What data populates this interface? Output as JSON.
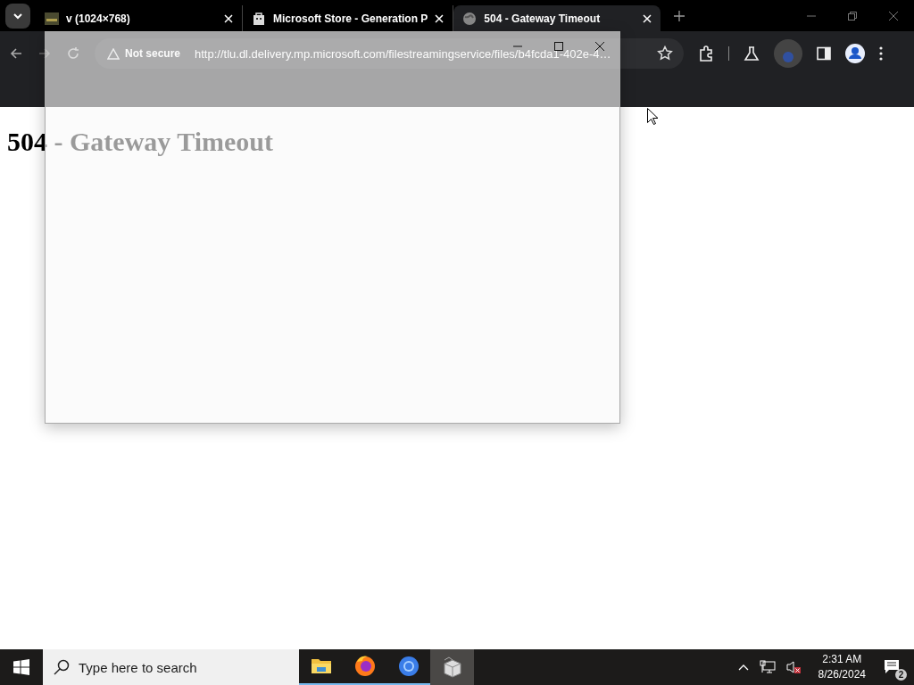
{
  "tabs": [
    {
      "title": "v (1024×768)",
      "kind": "thumbnail",
      "selected": false
    },
    {
      "title": "Microsoft Store - Generation P",
      "kind": "store",
      "selected": false
    },
    {
      "title": "504 - Gateway Timeout",
      "kind": "globe",
      "selected": true
    }
  ],
  "toolbar": {
    "security": "Not secure",
    "url_host": "http://tlu.dl.delivery.mp.microsoft.com",
    "url_path": "/filestreamingservice/files/b4fcda1-402e-4…"
  },
  "page": {
    "heading": "504 - Gateway Timeout"
  },
  "taskbar": {
    "search": {
      "placeholder": "Type here to search"
    },
    "apps": [
      {
        "kind": "folder",
        "running": true,
        "selected": false
      },
      {
        "kind": "firefox",
        "running": true,
        "selected": false
      },
      {
        "kind": "chrome",
        "running": true,
        "selected": false
      },
      {
        "kind": "package",
        "running": false,
        "selected": true
      }
    ],
    "time": "2:31 AM",
    "date": "8/26/2024",
    "notifications": "2"
  }
}
